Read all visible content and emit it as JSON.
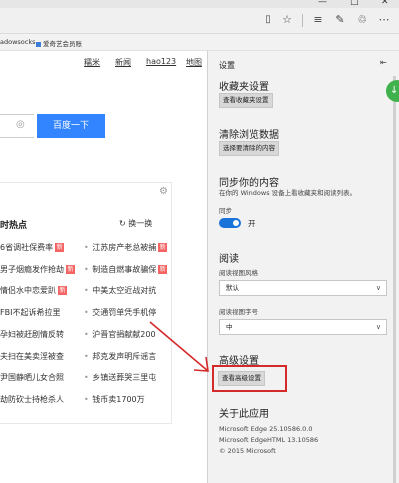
{
  "browser": {
    "favorites_bar": {
      "items": [
        {
          "label": "adowsocks"
        },
        {
          "label": "爱奇艺会员账"
        }
      ]
    },
    "toolbar_icons": [
      "reading-view-icon",
      "favorites-star-icon",
      "hub-icon",
      "web-note-icon",
      "share-icon"
    ]
  },
  "page": {
    "top_links": [
      "糯米",
      "新闻",
      "hao123",
      "地图"
    ],
    "search_button": "百度一下",
    "hot": {
      "title": "时热点",
      "refresh": "换一换",
      "left": [
        {
          "text": "6省调社保费率",
          "new": "新"
        },
        {
          "text": "男子烟瘾发作抢劫",
          "new": "新"
        },
        {
          "text": "情侣水中恋爱趴",
          "new": "新"
        },
        {
          "text": "FBI不起诉希拉里",
          "new": ""
        },
        {
          "text": "孕妇被赶剧情反转",
          "new": ""
        },
        {
          "text": "夫扫在美卖淫被查",
          "new": ""
        },
        {
          "text": "尹国静晒儿女合照",
          "new": ""
        },
        {
          "text": "劫防砍士持枪杀人",
          "new": ""
        }
      ],
      "right": [
        {
          "text": "江苏房产老总被捕",
          "new": "新"
        },
        {
          "text": "制造自燃事故骗保",
          "new": "新"
        },
        {
          "text": "中美太空近战对抗",
          "new": ""
        },
        {
          "text": "交通罚单凭手机停",
          "new": ""
        },
        {
          "text": "沪晋官捐献献200",
          "new": ""
        },
        {
          "text": "邦克发声明斥谣言",
          "new": ""
        },
        {
          "text": "乡镇送葬哭三里屯",
          "new": ""
        },
        {
          "text": "钱币卖1700万",
          "new": ""
        }
      ]
    }
  },
  "settings": {
    "title": "设置",
    "favorites": {
      "heading": "收藏夹设置",
      "button": "查看收藏夹设置"
    },
    "clear": {
      "heading": "清除浏览数据",
      "button": "选择要清除的内容"
    },
    "sync": {
      "heading": "同步你的内容",
      "desc": "在你的 Windows 设备上看收藏夹和阅读列表。",
      "label": "同步",
      "state": "开"
    },
    "reading": {
      "heading": "阅读",
      "style_label": "阅读视图风格",
      "style_value": "默认",
      "font_label": "阅读视图字号",
      "font_value": "中"
    },
    "advanced": {
      "heading": "高级设置",
      "button": "查看高级设置"
    },
    "about": {
      "heading": "关于此应用",
      "lines": [
        "Microsoft Edge 25.10586.0.0",
        "Microsoft EdgeHTML 13.10586",
        "© 2015 Microsoft"
      ]
    }
  },
  "colors": {
    "accent": "#3385ff",
    "toggle": "#1a73d9",
    "highlight": "#d42a2a",
    "new_badge": "#f46464"
  }
}
